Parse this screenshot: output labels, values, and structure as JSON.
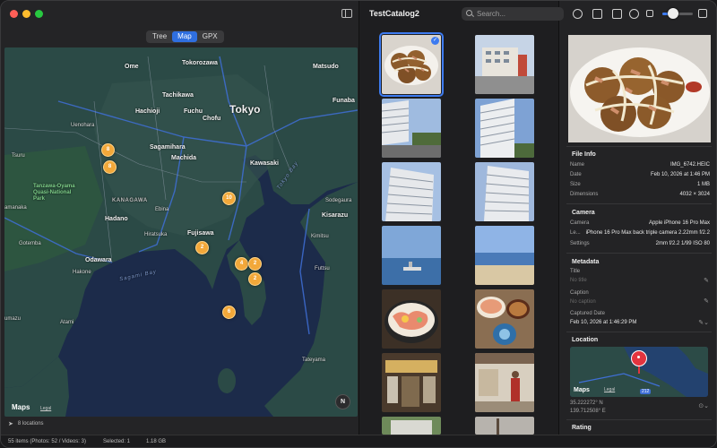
{
  "window": {
    "title": "TestCatalog2"
  },
  "view_tabs": [
    {
      "label": "Tree",
      "active": false
    },
    {
      "label": "Map",
      "active": true
    },
    {
      "label": "GPX",
      "active": false
    }
  ],
  "map": {
    "labels": {
      "ome": "Ome",
      "tokorozawa": "Tokorozawa",
      "matsudo": "Matsudo",
      "tachikawa": "Tachikawa",
      "hachioji": "Hachioji",
      "fuchu": "Fuchu",
      "chofu": "Chofu",
      "tokyo": "Tokyo",
      "funabashi": "Funaba",
      "uenohara": "Uenohara",
      "sagamihara": "Sagamihara",
      "machida": "Machida",
      "tsuru": "Tsuru",
      "kawasaki": "Kawasaki",
      "tanzawa": "Tanzawa-Oyama Quasi-National Park",
      "kanagawa": "KANAGAWA",
      "sodegaura": "Sodegaura",
      "hadano": "Hadano",
      "ebina": "Ebina",
      "kisarazu": "Kisarazu",
      "amanaka": "amanaka",
      "hiratsuka": "Hiratsuka",
      "fujisawa": "Fujisawa",
      "kimitsu": "Kimitsu",
      "gotemba": "Gotemba",
      "odawara": "Odawara",
      "hakone": "Hakone",
      "sagami_bay": "Sagami Bay",
      "tokyo_bay": "Tokyo Bay",
      "futtsu": "Futtsu",
      "numazu": "umazu",
      "atami": "Atami",
      "tateyama": "Tateyama",
      "road_16": "16",
      "road_20": "20",
      "road_246": "246",
      "road_1": "1",
      "road_6": "6"
    },
    "clusters": [
      "8",
      "8",
      "10",
      "2",
      "4",
      "2",
      "2",
      "6"
    ],
    "compass": "N",
    "maps_logo": " Maps",
    "legal": "Legal",
    "location_count": "8 locations",
    "colors": {
      "water": "#1c2b4a",
      "land": "#2d4c48",
      "cluster": "#f2a83a"
    }
  },
  "grid": {
    "thumbnails": [
      {
        "name": "takoyaki",
        "selected": true,
        "check": "✓"
      },
      {
        "name": "building-street"
      },
      {
        "name": "apartment-low"
      },
      {
        "name": "apartment-sky"
      },
      {
        "name": "apartment-tall-1"
      },
      {
        "name": "apartment-tall-2"
      },
      {
        "name": "sea-boat"
      },
      {
        "name": "beach"
      },
      {
        "name": "sashimi-bowl"
      },
      {
        "name": "lunch-set"
      },
      {
        "name": "shop-interior-1"
      },
      {
        "name": "shop-interior-2"
      },
      {
        "name": "partial-1"
      },
      {
        "name": "partial-2"
      }
    ]
  },
  "toolbar": {
    "search_placeholder": "Search...",
    "icons": [
      "filter-icon",
      "folder-icon",
      "export-icon",
      "gear-icon",
      "thumbnail-size-slider",
      "sidebar-right-icon"
    ],
    "thumb_size_fraction": 0.35
  },
  "inspector": {
    "file_info": {
      "title": "File Info",
      "rows": [
        {
          "k": "Name",
          "v": "IMG_6742.HEIC"
        },
        {
          "k": "Date",
          "v": "Feb 10, 2026 at 1:46 PM"
        },
        {
          "k": "Size",
          "v": "1 MB"
        },
        {
          "k": "Dimensions",
          "v": "4032 × 3024"
        }
      ]
    },
    "camera": {
      "title": "Camera",
      "rows": [
        {
          "k": "Camera",
          "v": "Apple iPhone 16 Pro Max"
        },
        {
          "k": "Le...",
          "v": "iPhone 16 Pro Max back triple camera 2.22mm f/2.2"
        },
        {
          "k": "Settings",
          "v": "2mm f/2.2 1/99 ISO 80"
        }
      ]
    },
    "metadata": {
      "title": "Metadata",
      "title_label": "Title",
      "title_placeholder": "No title",
      "caption_label": "Caption",
      "caption_placeholder": "No caption",
      "captured_label": "Captured Date",
      "captured_value": "Feb 10, 2026 at 1:46:29 PM"
    },
    "location": {
      "title": "Location",
      "lat": "35.222272° N",
      "lon": "139.712508° E",
      "maps_logo": " Maps",
      "legal": "Legal",
      "road": "212"
    },
    "rating": {
      "title": "Rating"
    }
  },
  "statusbar": {
    "items": "55 items (Photos: 52 / Videos: 3)",
    "selected": "Selected: 1",
    "size": "1.18 GB"
  }
}
